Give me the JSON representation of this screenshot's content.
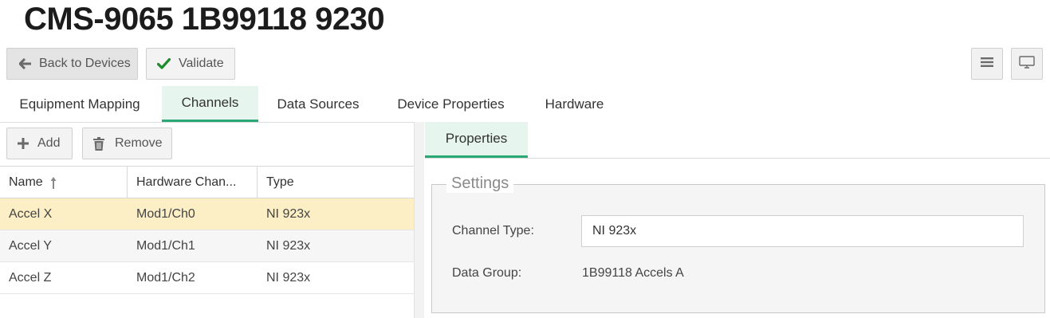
{
  "page": {
    "title": "CMS-9065 1B99118 9230"
  },
  "toolbar": {
    "back_label": "Back to Devices",
    "validate_label": "Validate",
    "menu_icon": "hamburger-menu-icon",
    "monitor_icon": "monitor-icon"
  },
  "tabs": [
    {
      "label": "Equipment Mapping",
      "active": false
    },
    {
      "label": "Channels",
      "active": true
    },
    {
      "label": "Data Sources",
      "active": false
    },
    {
      "label": "Device Properties",
      "active": false
    },
    {
      "label": "Hardware",
      "active": false
    }
  ],
  "channels": {
    "add_label": "Add",
    "remove_label": "Remove",
    "columns": [
      "Name",
      "Hardware Chan...",
      "Type"
    ],
    "sort_column": "Name",
    "rows": [
      {
        "name": "Accel X",
        "hardware_channel": "Mod1/Ch0",
        "type": "NI 923x",
        "selected": true
      },
      {
        "name": "Accel Y",
        "hardware_channel": "Mod1/Ch1",
        "type": "NI 923x",
        "selected": false
      },
      {
        "name": "Accel Z",
        "hardware_channel": "Mod1/Ch2",
        "type": "NI 923x",
        "selected": false
      }
    ]
  },
  "properties": {
    "tab_label": "Properties",
    "settings_legend": "Settings",
    "channel_type_label": "Channel Type:",
    "channel_type_value": "NI 923x",
    "data_group_label": "Data Group:",
    "data_group_value": "1B99118 Accels A"
  },
  "colors": {
    "accent": "#2aa876",
    "active_tab_bg": "#e7f5ef",
    "selected_row_bg": "#fdefc5",
    "validate_check": "#1e8c2e"
  }
}
